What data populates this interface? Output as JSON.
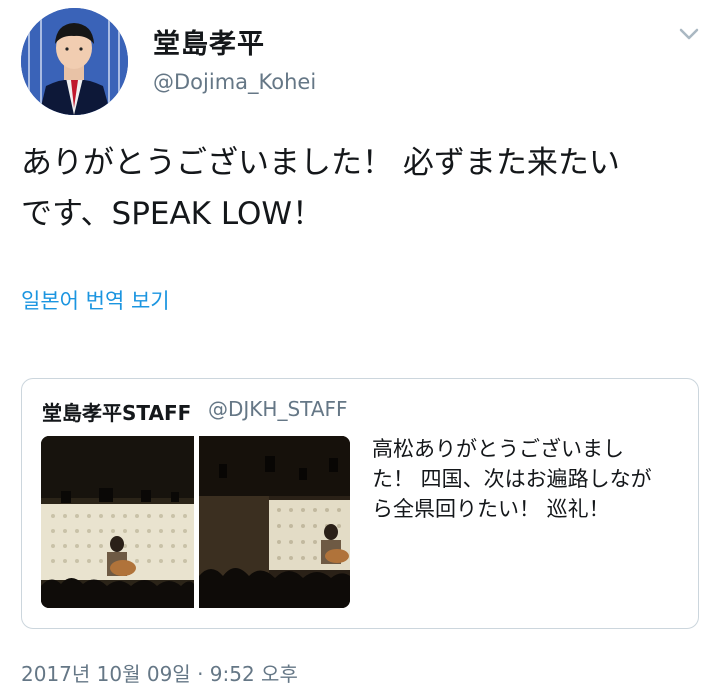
{
  "author": {
    "display_name": "堂島孝平",
    "handle": "@Dojima_Kohei",
    "avatar_icon": "profile-photo"
  },
  "menu": {
    "icon": "chevron-down-icon"
  },
  "tweet": {
    "line1": "ありがとうございました！ 必ずまた来たい",
    "line2": "です、SPEAK LOW！",
    "translate_link": "일본어 번역 보기"
  },
  "quoted_tweet": {
    "display_name": "堂島孝平STAFF",
    "handle": "@DJKH_STAFF",
    "text_line1": "高松ありがとうございまし",
    "text_line2": "た！ 四国、次はお遍路しなが",
    "text_line3": "ら全県回りたい！ 巡礼！"
  },
  "meta": {
    "timestamp": "2017년 10월 09일 · 9:52 오후"
  },
  "colors": {
    "link": "#1b95e0",
    "secondary_text": "#657786",
    "border": "#ccd6dd"
  }
}
